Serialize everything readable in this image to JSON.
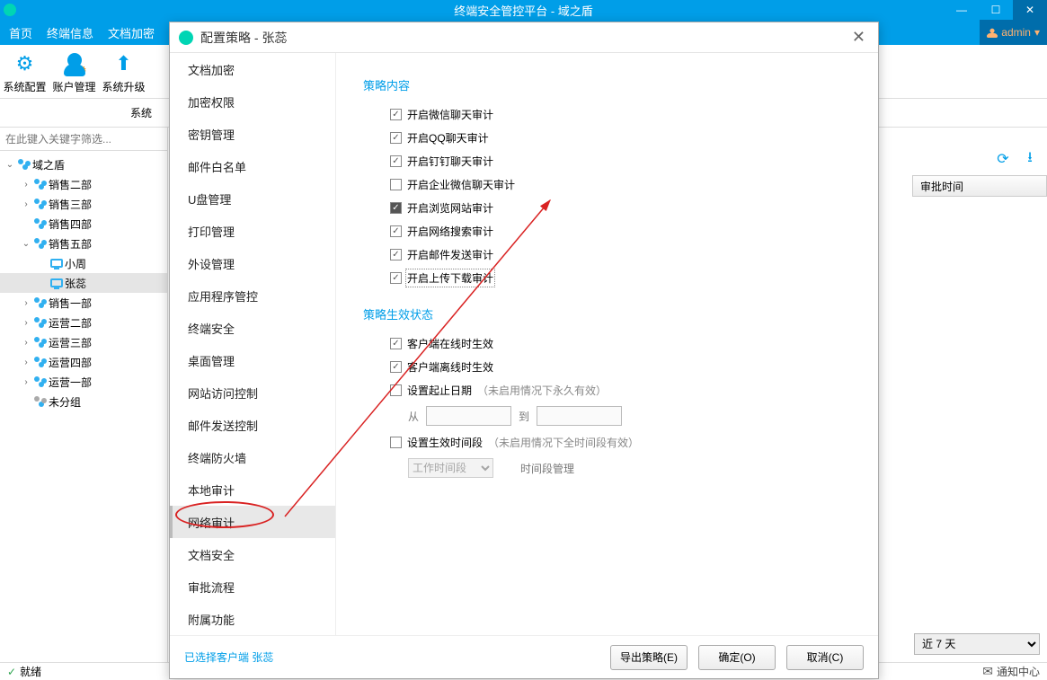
{
  "app": {
    "title": "终端安全管控平台 - 域之盾"
  },
  "menubar": {
    "items": [
      "首页",
      "终端信息",
      "文档加密"
    ],
    "admin": "admin"
  },
  "toolbar": {
    "items": [
      {
        "label": "系统配置",
        "name": "system-config"
      },
      {
        "label": "账户管理",
        "name": "account-manage"
      },
      {
        "label": "系统升级",
        "name": "system-upgrade"
      }
    ]
  },
  "subbar": {
    "label": "系统"
  },
  "search": {
    "placeholder": "在此键入关键字筛选..."
  },
  "tree": [
    {
      "depth": 0,
      "exp": "v",
      "icon": "group",
      "label": "域之盾"
    },
    {
      "depth": 1,
      "exp": ">",
      "icon": "group",
      "label": "销售二部"
    },
    {
      "depth": 1,
      "exp": ">",
      "icon": "group",
      "label": "销售三部"
    },
    {
      "depth": 1,
      "exp": "",
      "icon": "group",
      "label": "销售四部"
    },
    {
      "depth": 1,
      "exp": "v",
      "icon": "group",
      "label": "销售五部"
    },
    {
      "depth": 2,
      "exp": "",
      "icon": "pc",
      "label": "小周"
    },
    {
      "depth": 2,
      "exp": "",
      "icon": "pc",
      "label": "张蕊",
      "sel": true
    },
    {
      "depth": 1,
      "exp": ">",
      "icon": "group",
      "label": "销售一部"
    },
    {
      "depth": 1,
      "exp": ">",
      "icon": "group",
      "label": "运营二部"
    },
    {
      "depth": 1,
      "exp": ">",
      "icon": "group",
      "label": "运营三部"
    },
    {
      "depth": 1,
      "exp": ">",
      "icon": "group",
      "label": "运营四部"
    },
    {
      "depth": 1,
      "exp": ">",
      "icon": "group",
      "label": "运营一部"
    },
    {
      "depth": 1,
      "exp": "",
      "icon": "group",
      "label": "未分组",
      "grey": true
    }
  ],
  "grid": {
    "col": "审批时间"
  },
  "filter": {
    "value": "近 7 天"
  },
  "status": {
    "ready": "就绪",
    "notify": "通知中心"
  },
  "modal": {
    "title": "配置策略 - 张蕊",
    "categories": [
      "文档加密",
      "加密权限",
      "密钥管理",
      "邮件白名单",
      "U盘管理",
      "打印管理",
      "外设管理",
      "应用程序管控",
      "终端安全",
      "桌面管理",
      "网站访问控制",
      "邮件发送控制",
      "终端防火墙",
      "本地审计",
      "网络审计",
      "文档安全",
      "审批流程",
      "附属功能"
    ],
    "selected_index": 14,
    "sec1": "策略内容",
    "opts1": [
      {
        "label": "开启微信聊天审计",
        "on": true
      },
      {
        "label": "开启QQ聊天审计",
        "on": true
      },
      {
        "label": "开启钉钉聊天审计",
        "on": true
      },
      {
        "label": "开启企业微信聊天审计",
        "on": false
      },
      {
        "label": "开启浏览网站审计",
        "on": true,
        "solid": true
      },
      {
        "label": "开启网络搜索审计",
        "on": true
      },
      {
        "label": "开启邮件发送审计",
        "on": true
      },
      {
        "label": "开启上传下载审计",
        "on": true,
        "dotted": true
      }
    ],
    "sec2": "策略生效状态",
    "opts2": [
      {
        "label": "客户端在线时生效",
        "on": true
      },
      {
        "label": "客户端离线时生效",
        "on": true
      },
      {
        "label": "设置起止日期",
        "hint": "（未启用情况下永久有效）",
        "on": false
      },
      {
        "label": "设置生效时间段",
        "hint": "（未启用情况下全时间段有效）",
        "on": false
      }
    ],
    "date_row": {
      "from": "从",
      "to": "到"
    },
    "time_row": {
      "label": "工作时间段",
      "link": "时间段管理"
    },
    "footer": {
      "selected": "已选择客户端 张蕊",
      "export": "导出策略(E)",
      "ok": "确定(O)",
      "cancel": "取消(C)"
    }
  }
}
